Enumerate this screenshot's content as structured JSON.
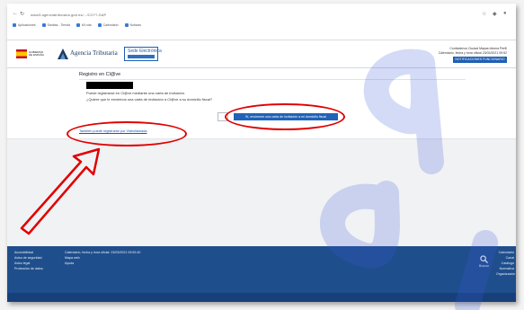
{
  "browser": {
    "url": "www3.agenciatributaria.gob.es/.../CO??-SAP",
    "bookmarks": [
      {
        "label": "Aplicaciones"
      },
      {
        "label": "Sanitas - Tienda"
      },
      {
        "label": "Mi ruta"
      },
      {
        "label": "Calendario"
      },
      {
        "label": "Noticias"
      }
    ]
  },
  "header": {
    "logo_text_1": "GOBIERNO",
    "logo_text_2": "DE ESPAÑA",
    "aeat_name": "Agencia Tributaria",
    "sede_label": "Sede Electrónica",
    "links": "Contáctenos  Ciudad  Mapas  Idioma  Perfil",
    "datetime": "Calendario, fecha y hora oficial 23/03/2021 09:52",
    "official_button": "NOTIFICACIONES FUNCIONARIO"
  },
  "content": {
    "page_title": "Registro en Cl@ve",
    "line1": "Puede registrarse en Cl@ve mediante una carta de invitación.",
    "line2": "¿Quiere que le enviemos una carta de invitación a Cl@ve a su domicilio fiscal?",
    "send_button": "Sí, envíenme una carta de invitación a mi domicilio fiscal",
    "alt_link": "También puede registrarse por Videollamada"
  },
  "footer": {
    "col1": [
      "Accesibilidad",
      "Aviso de seguridad",
      "Aviso legal",
      "Protección de datos"
    ],
    "col2": [
      "Calendario, fecha y hora oficial: 23/03/2021 09:52:40",
      "Mapa web",
      "Ayuda"
    ],
    "search_label": "Buscar",
    "col4": [
      "Calendario",
      "Canal",
      "Catálogo",
      "Normativa",
      "Organización"
    ]
  },
  "colors": {
    "annotation": "#e00000",
    "primary": "#1f62b8",
    "footer": "#1f4e8c"
  },
  "watermark": "cad"
}
